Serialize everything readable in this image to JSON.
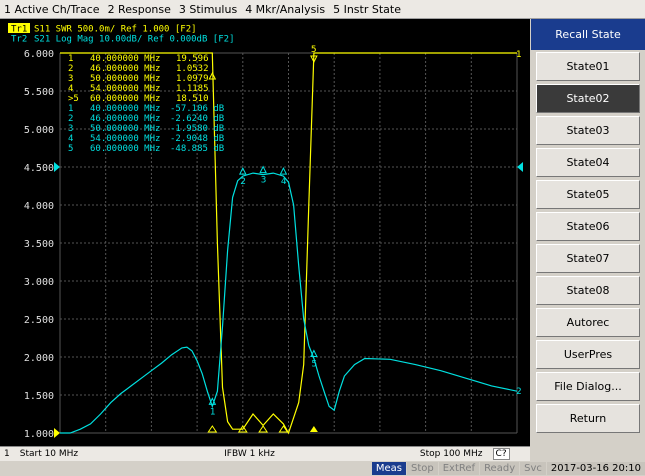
{
  "menu": [
    "1 Active Ch/Trace",
    "2 Response",
    "3 Stimulus",
    "4 Mkr/Analysis",
    "5 Instr State"
  ],
  "trace1": {
    "tag": "Tr1",
    "header": "S11  SWR 500.0m/ Ref 1.000 [F2]",
    "color": "#ffff00",
    "markers": [
      {
        "label": " 1",
        "freq": "40.000000 MHz",
        "value": "19.596"
      },
      {
        "label": " 2",
        "freq": "46.000000 MHz",
        "value": "1.0532"
      },
      {
        "label": " 3",
        "freq": "50.000000 MHz",
        "value": "1.0979"
      },
      {
        "label": " 4",
        "freq": "54.000000 MHz",
        "value": "1.1185"
      },
      {
        "label": ">5",
        "freq": "60.000000 MHz",
        "value": "18.510"
      }
    ]
  },
  "trace2": {
    "tag": "Tr2",
    "header": "S21  Log Mag 10.00dB/ Ref 0.000dB [F2]",
    "color": "#00e0e0",
    "markers": [
      {
        "label": " 1",
        "freq": "40.000000 MHz",
        "value": "-57.106 dB"
      },
      {
        "label": " 2",
        "freq": "46.000000 MHz",
        "value": "-2.6240 dB"
      },
      {
        "label": " 3",
        "freq": "50.000000 MHz",
        "value": "-1.9580 dB"
      },
      {
        "label": " 4",
        "freq": "54.000000 MHz",
        "value": "-2.9048 dB"
      },
      {
        "label": " 5",
        "freq": "60.000000 MHz",
        "value": "-48.885 dB"
      }
    ]
  },
  "y_ticks": [
    "6.000",
    "5.500",
    "5.000",
    "4.500",
    "4.000",
    "3.500",
    "3.000",
    "2.500",
    "2.000",
    "1.500",
    "1.000"
  ],
  "chart_data": {
    "type": "line",
    "x_range_mhz": [
      10,
      100
    ],
    "ylim": [
      1.0,
      6.0
    ],
    "series": [
      {
        "name": "S11",
        "x": [
          10,
          20,
          30,
          35,
          38,
          39,
          40,
          41,
          42,
          43,
          44,
          46,
          48,
          50,
          52,
          54,
          55,
          56,
          57,
          58,
          59,
          60,
          61,
          62,
          65,
          70,
          80,
          90,
          100
        ],
        "y": [
          6.0,
          6.0,
          6.0,
          6.0,
          6.0,
          6.0,
          6.0,
          3.5,
          1.6,
          1.15,
          1.05,
          1.05,
          1.25,
          1.1,
          1.25,
          1.12,
          1.0,
          1.2,
          1.4,
          1.9,
          4.0,
          6.0,
          6.0,
          6.0,
          6.0,
          6.0,
          6.0,
          6.0,
          6.0
        ]
      },
      {
        "name": "S21",
        "x": [
          10,
          12,
          14,
          16,
          18,
          20,
          22,
          24,
          26,
          28,
          30,
          32,
          34,
          35,
          36,
          37,
          38,
          39,
          40,
          41,
          42,
          43,
          44,
          45,
          46,
          48,
          50,
          52,
          54,
          55,
          56,
          57,
          58,
          59,
          60,
          61,
          62,
          63,
          64,
          65,
          66,
          68,
          70,
          75,
          80,
          85,
          90,
          95,
          100
        ],
        "y": [
          1.0,
          1.0,
          1.05,
          1.12,
          1.25,
          1.4,
          1.52,
          1.62,
          1.72,
          1.82,
          1.92,
          2.03,
          2.12,
          2.13,
          2.08,
          1.95,
          1.78,
          1.55,
          1.35,
          1.55,
          2.4,
          3.4,
          4.1,
          4.32,
          4.38,
          4.42,
          4.4,
          4.42,
          4.38,
          4.3,
          4.0,
          3.2,
          2.5,
          2.15,
          1.98,
          1.75,
          1.55,
          1.35,
          1.3,
          1.55,
          1.75,
          1.9,
          1.98,
          1.97,
          1.9,
          1.82,
          1.72,
          1.62,
          1.55
        ]
      }
    ]
  },
  "status": {
    "channel": "1",
    "start": "Start 10 MHz",
    "ifbw": "IFBW 1 kHz",
    "stop": "Stop 100 MHz",
    "cq": "C?"
  },
  "bottom": [
    "Meas",
    "Stop",
    "ExtRef",
    "Ready",
    "Svc",
    "2017-03-16 20:10"
  ],
  "softkeys": {
    "title": "Recall State",
    "items": [
      "State01",
      "State02",
      "State03",
      "State04",
      "State05",
      "State06",
      "State07",
      "State08",
      "Autorec",
      "UserPres",
      "File Dialog...",
      "Return"
    ]
  }
}
